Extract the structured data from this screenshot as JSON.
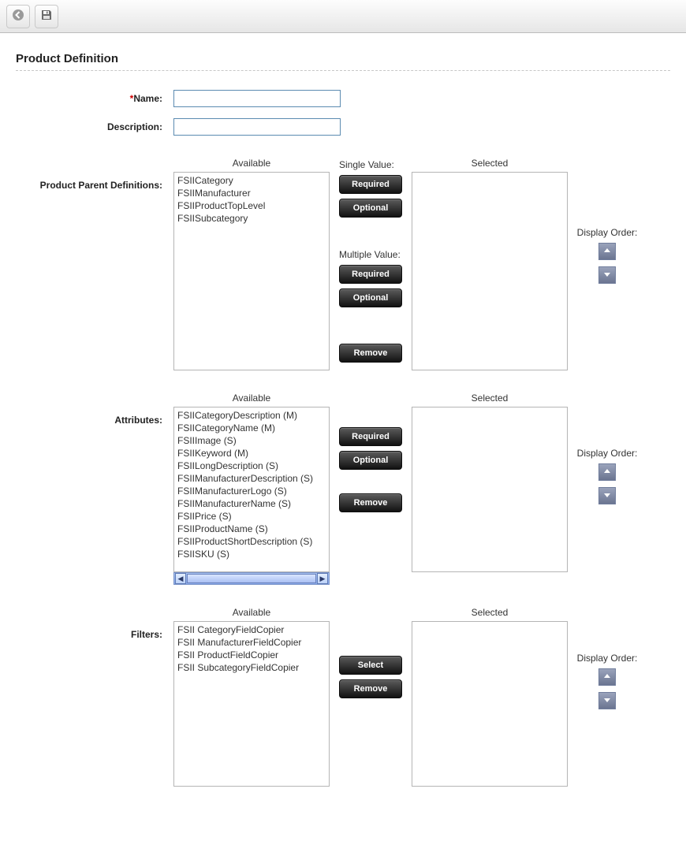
{
  "page": {
    "title": "Product Definition"
  },
  "fields": {
    "name_label": "Name:",
    "description_label": "Description:",
    "name_value": "",
    "description_value": ""
  },
  "labels": {
    "available": "Available",
    "selected": "Selected",
    "display_order": "Display Order:",
    "single_value": "Single Value:",
    "multiple_value": "Multiple Value:"
  },
  "buttons": {
    "required": "Required",
    "optional": "Optional",
    "remove": "Remove",
    "select": "Select"
  },
  "sections": {
    "parents": {
      "label": "Product Parent Definitions:",
      "available": [
        "FSIICategory",
        "FSIIManufacturer",
        "FSIIProductTopLevel",
        "FSIISubcategory"
      ],
      "selected": []
    },
    "attributes": {
      "label": "Attributes:",
      "available": [
        "FSIICategoryDescription (M)",
        "FSIICategoryName (M)",
        "FSIIImage (S)",
        "FSIIKeyword (M)",
        "FSIILongDescription (S)",
        "FSIIManufacturerDescription (S)",
        "FSIIManufacturerLogo (S)",
        "FSIIManufacturerName (S)",
        "FSIIPrice (S)",
        "FSIIProductName (S)",
        "FSIIProductShortDescription (S)",
        "FSIISKU (S)"
      ],
      "selected": []
    },
    "filters": {
      "label": "Filters:",
      "available": [
        "FSII CategoryFieldCopier",
        "FSII ManufacturerFieldCopier",
        "FSII ProductFieldCopier",
        "FSII SubcategoryFieldCopier"
      ],
      "selected": []
    }
  }
}
